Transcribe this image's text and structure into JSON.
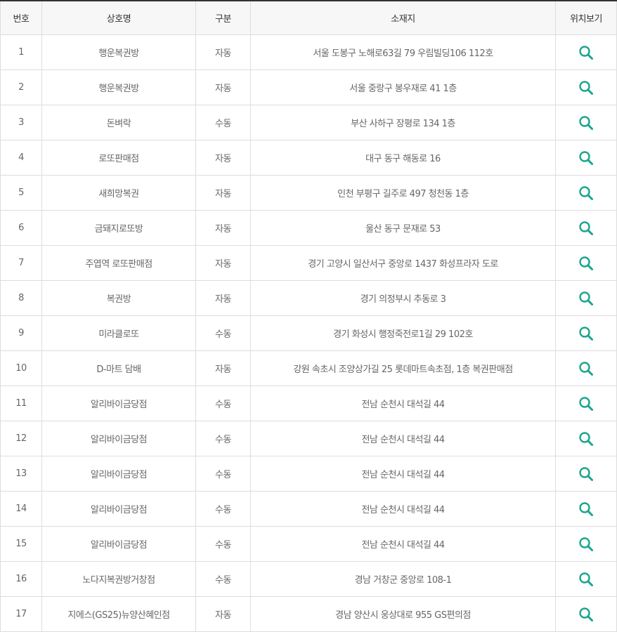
{
  "table": {
    "headers": {
      "no": "번호",
      "name": "상호명",
      "type": "구분",
      "address": "소재지",
      "map": "위치보기"
    },
    "map_icon": "search-icon",
    "accent_color": "#1aa58c",
    "rows": [
      {
        "no": "1",
        "name": "행운복권방",
        "type": "자동",
        "address": "서울 도봉구 노해로63길 79 우림빌딩106 112호"
      },
      {
        "no": "2",
        "name": "행운복권방",
        "type": "자동",
        "address": "서울 중랑구 봉우재로 41 1층"
      },
      {
        "no": "3",
        "name": "돈벼락",
        "type": "수동",
        "address": "부산 사하구 장평로 134 1층"
      },
      {
        "no": "4",
        "name": "로또판매점",
        "type": "자동",
        "address": "대구 동구 해동로 16"
      },
      {
        "no": "5",
        "name": "새희망복권",
        "type": "자동",
        "address": "인천 부평구 길주로 497 청천동 1층"
      },
      {
        "no": "6",
        "name": "금돼지로또방",
        "type": "자동",
        "address": "울산 동구 문재로 53"
      },
      {
        "no": "7",
        "name": "주엽역 로또판매점",
        "type": "자동",
        "address": "경기 고양시 일산서구 중앙로 1437 화성프라자 도로"
      },
      {
        "no": "8",
        "name": "복권방",
        "type": "자동",
        "address": "경기 의정부시 추동로 3"
      },
      {
        "no": "9",
        "name": "미라클로또",
        "type": "수동",
        "address": "경기 화성시 행정죽전로1길 29 102호"
      },
      {
        "no": "10",
        "name": "D-마트 담배",
        "type": "자동",
        "address": "강원 속초시 조양상가길 25 롯데마트속초점, 1층 복권판매점"
      },
      {
        "no": "11",
        "name": "알리바이금당점",
        "type": "수동",
        "address": "전남 순천시 대석길 44"
      },
      {
        "no": "12",
        "name": "알리바이금당점",
        "type": "수동",
        "address": "전남 순천시 대석길 44"
      },
      {
        "no": "13",
        "name": "알리바이금당점",
        "type": "수동",
        "address": "전남 순천시 대석길 44"
      },
      {
        "no": "14",
        "name": "알리바이금당점",
        "type": "수동",
        "address": "전남 순천시 대석길 44"
      },
      {
        "no": "15",
        "name": "알리바이금당점",
        "type": "수동",
        "address": "전남 순천시 대석길 44"
      },
      {
        "no": "16",
        "name": "노다지복권방거창점",
        "type": "수동",
        "address": "경남 거창군 중앙로 108-1"
      },
      {
        "no": "17",
        "name": "지에스(GS25)뉴양산혜인점",
        "type": "자동",
        "address": "경남 양산시 웅상대로 955 GS편의점"
      }
    ]
  }
}
